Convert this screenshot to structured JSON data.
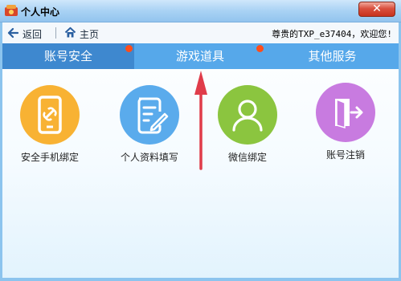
{
  "window": {
    "title": "个人中心",
    "close_label": "✕"
  },
  "toolbar": {
    "back_label": "返回",
    "home_label": "主页",
    "welcome_text": "尊贵的TXP_e37404，欢迎您!"
  },
  "tabs": [
    {
      "label": "账号安全",
      "selected": true,
      "badge_dot": true
    },
    {
      "label": "游戏道具",
      "selected": false,
      "badge_dot": true
    },
    {
      "label": "其他服务",
      "selected": false,
      "badge_dot": false
    }
  ],
  "features": [
    {
      "label": "安全手机绑定",
      "icon": "phone-link-icon",
      "color": "#f8b233"
    },
    {
      "label": "个人资料填写",
      "icon": "edit-document-icon",
      "color": "#5aabec"
    },
    {
      "label": "微信绑定",
      "icon": "user-icon",
      "color": "#8bc53f"
    },
    {
      "label": "账号注销",
      "icon": "logout-door-icon",
      "color": "#c87be0"
    }
  ],
  "colors": {
    "tab_active": "#3e88cf",
    "tab_bar": "#56a8ea",
    "badge_dot": "#ff4d1a",
    "annotation_arrow": "#e03c4a"
  }
}
